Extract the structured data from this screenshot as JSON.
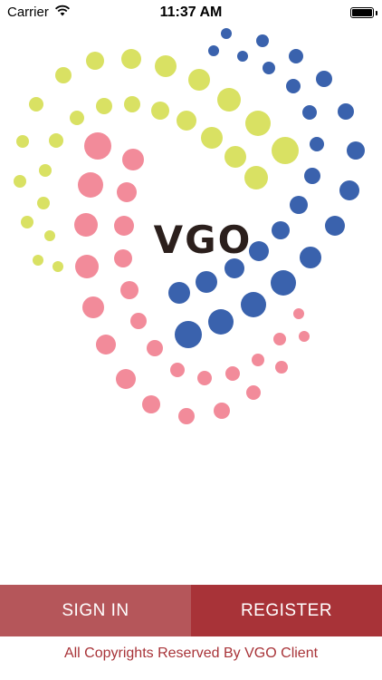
{
  "status_bar": {
    "carrier": "Carrier",
    "time": "11:37 AM",
    "wifi_icon": "wifi-icon",
    "battery_icon": "battery-icon"
  },
  "logo": {
    "text": "VGO",
    "colors": {
      "yellow": "#d9e163",
      "blue": "#3a62ad",
      "pink": "#f28b9a"
    }
  },
  "actions": {
    "sign_in": "SIGN IN",
    "register": "REGISTER",
    "sign_in_color": "#b5565a",
    "register_color": "#a83338"
  },
  "footer": {
    "copyright": "All Copyrights Reserved By VGO Client"
  }
}
